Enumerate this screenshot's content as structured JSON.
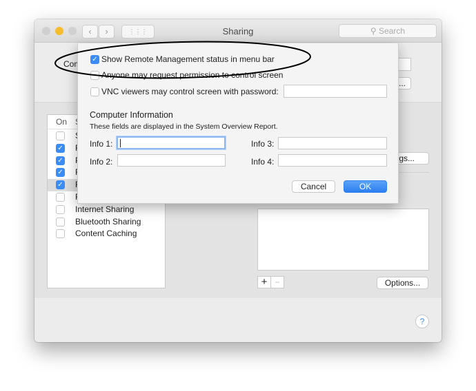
{
  "window": {
    "title": "Sharing",
    "search_placeholder": "Search",
    "back": "‹",
    "forward": "›",
    "grid": "⋮⋮⋮"
  },
  "behind": {
    "computer_name_label": "Com",
    "list_header_on": "On",
    "list_header_service": "S",
    "services": [
      {
        "label": "S",
        "checked": false
      },
      {
        "label": "F",
        "checked": true
      },
      {
        "label": "P",
        "checked": true
      },
      {
        "label": "R",
        "checked": true
      },
      {
        "label": "R",
        "checked": true,
        "selected": true
      },
      {
        "label": "R",
        "checked": false
      },
      {
        "label": "Internet Sharing",
        "checked": false
      },
      {
        "label": "Bluetooth Sharing",
        "checked": false
      },
      {
        "label": "Content Caching",
        "checked": false
      }
    ],
    "settings_button": "ings...",
    "edit_button": "...",
    "add_button": "+",
    "remove_button": "−",
    "options_button": "Options...",
    "help_button": "?"
  },
  "sheet": {
    "show_status": {
      "label": "Show Remote Management status in menu bar",
      "checked": true
    },
    "anyone_request": {
      "label": "Anyone may request permission to control screen",
      "checked": false
    },
    "vnc": {
      "label": "VNC viewers may control screen with password:",
      "checked": false,
      "value": ""
    },
    "section_title": "Computer Information",
    "section_note": "These fields are displayed in the System Overview Report.",
    "info1": {
      "label": "Info 1:",
      "value": ""
    },
    "info2": {
      "label": "Info 2:",
      "value": ""
    },
    "info3": {
      "label": "Info 3:",
      "value": ""
    },
    "info4": {
      "label": "Info 4:",
      "value": ""
    },
    "cancel": "Cancel",
    "ok": "OK"
  },
  "colors": {
    "accent": "#3b8cf5",
    "annotation": "#000000"
  }
}
